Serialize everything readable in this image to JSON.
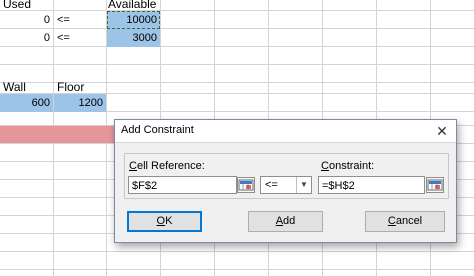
{
  "sheet": {
    "header_used": "Used",
    "header_available": "Available",
    "rows": [
      {
        "used": "0",
        "op": "<=",
        "available": "10000"
      },
      {
        "used": "0",
        "op": "<=",
        "available": "3000"
      }
    ],
    "label_wall": "Wall",
    "label_floor": "Floor",
    "wall_value": "600",
    "floor_value": "1200"
  },
  "colors": {
    "cell_blue": "#9dc3e6",
    "cell_pink": "#e6959b",
    "default_button_border": "#0078d7"
  },
  "dialog": {
    "title": "Add Constraint",
    "cell_reference_label_prefix": "",
    "cell_reference_label_underlined": "C",
    "cell_reference_label_rest": "ell Reference:",
    "cell_reference_value": "$F$2",
    "constraint_label_prefix": "",
    "constraint_label_underlined": "C",
    "constraint_label_rest": "onstraint:",
    "constraint_value": "=$H$2",
    "operator_selected": "<=",
    "ok_label_underlined": "O",
    "ok_label_rest": "K",
    "add_label_underlined": "A",
    "add_label_rest": "dd",
    "cancel_label_underlined": "C",
    "cancel_label_rest": "ancel",
    "icons": {
      "close": "close-icon",
      "range_picker": "range-select-icon",
      "dropdown": "chevron-down-icon"
    }
  }
}
